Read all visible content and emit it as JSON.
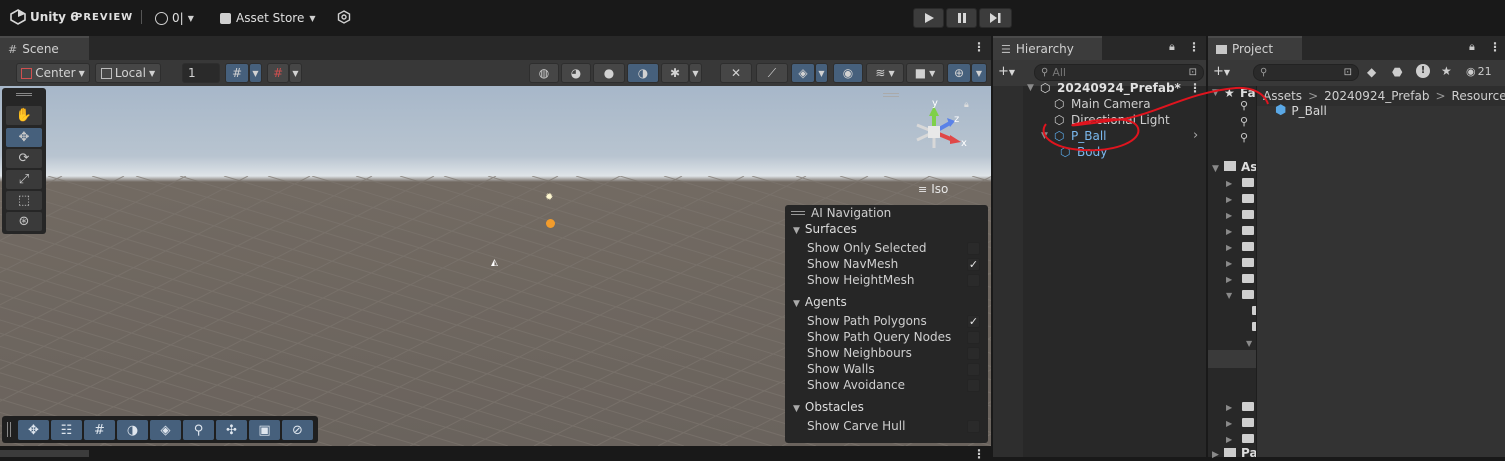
{
  "topbar": {
    "app_title": "Unity 6",
    "edition_badge": "PREVIEW",
    "account_count": "0|",
    "asset_store_label": "Asset Store",
    "play_icon": "play-icon",
    "pause_icon": "pause-icon",
    "step_icon": "step-icon"
  },
  "scene": {
    "tab_label": "Scene",
    "pivot_label": "Center",
    "space_label": "Local",
    "grid_value": "1",
    "iso_label": "Iso",
    "gizmo_axes": {
      "y": "y",
      "z": "z",
      "x": "x"
    }
  },
  "ai_navigation": {
    "title": "AI Navigation",
    "sections": [
      {
        "name": "Surfaces",
        "items": [
          {
            "label": "Show Only Selected",
            "checked": false
          },
          {
            "label": "Show NavMesh",
            "checked": true
          },
          {
            "label": "Show HeightMesh",
            "checked": false
          }
        ]
      },
      {
        "name": "Agents",
        "items": [
          {
            "label": "Show Path Polygons",
            "checked": true
          },
          {
            "label": "Show Path Query Nodes",
            "checked": false
          },
          {
            "label": "Show Neighbours",
            "checked": false
          },
          {
            "label": "Show Walls",
            "checked": false
          },
          {
            "label": "Show Avoidance",
            "checked": false
          }
        ]
      },
      {
        "name": "Obstacles",
        "items": [
          {
            "label": "Show Carve Hull",
            "checked": false
          }
        ]
      }
    ],
    "check_glyph": "✓"
  },
  "hierarchy": {
    "tab_label": "Hierarchy",
    "search_placeholder": "All",
    "scene_name": "20240924_Prefab*",
    "items": [
      {
        "label": "Main Camera",
        "depth": 1,
        "selected": false
      },
      {
        "label": "Directional Light",
        "depth": 1,
        "selected": false
      },
      {
        "label": "P_Ball",
        "depth": 1,
        "selected": true
      },
      {
        "label": "Body",
        "depth": 2,
        "selected": false
      }
    ]
  },
  "project": {
    "tab_label": "Project",
    "visible_count": "21",
    "breadcrumb": [
      "Assets",
      "20240924_Prefab",
      "Resources"
    ],
    "breadcrumb_sep": ">",
    "asset_item": "P_Ball",
    "tree_fav_label": "Fa",
    "tree_assets_label": "As",
    "tree_packages_label": "Pa"
  },
  "colors": {
    "accent": "#46607c",
    "prefab_blue": "#5aa8e6",
    "annotation": "#e0141e"
  }
}
